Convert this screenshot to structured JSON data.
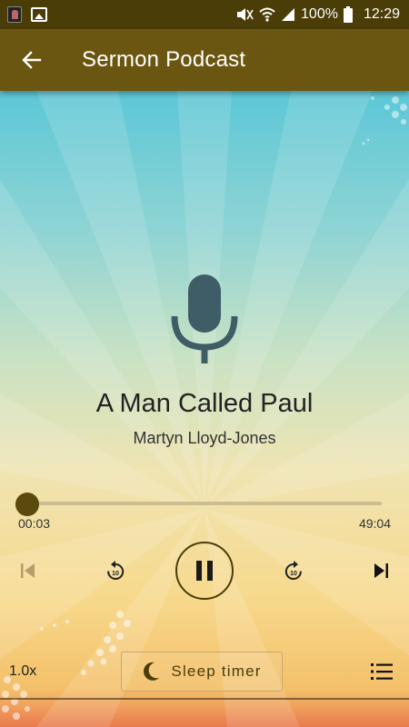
{
  "status_bar": {
    "battery": "100%",
    "time": "12:29",
    "icons": [
      "app-thumbnail-icon",
      "image-notification-icon",
      "mute-icon",
      "wifi-icon",
      "signal-icon",
      "battery-icon"
    ]
  },
  "app_bar": {
    "title": "Sermon Podcast",
    "back_icon": "arrow-left-icon"
  },
  "player": {
    "artwork_icon": "microphone-icon",
    "title": "A Man Called Paul",
    "artist": "Martyn Lloyd-Jones",
    "time_elapsed": "00:03",
    "time_total": "49:04",
    "progress_fraction": 0.001,
    "rewind_seconds": "10",
    "forward_seconds": "10",
    "state": "playing"
  },
  "footer": {
    "speed": "1.0x",
    "sleep_label": "Sleep timer",
    "sleep_icon": "moon-icon",
    "playlist_icon": "playlist-icon"
  },
  "colors": {
    "status_bar": "#4a3d08",
    "app_bar": "#6a5610",
    "accent": "#5b4a0e",
    "mic": "#3f5d66"
  }
}
